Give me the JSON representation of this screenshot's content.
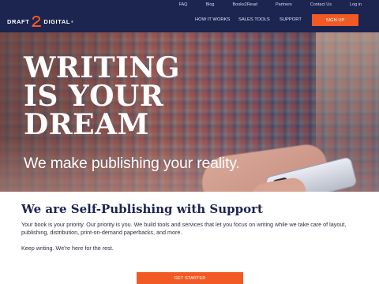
{
  "utility_nav": {
    "items": [
      "FAQ",
      "Blog",
      "Books2Read",
      "Partners",
      "Contact Us",
      "Log in"
    ]
  },
  "header": {
    "logo_left": "DRAFT",
    "logo_right": "DIGITAL",
    "logo_mark": "2",
    "nav": [
      "HOW IT WORKS",
      "SALES TOOLS",
      "SUPPORT"
    ],
    "signup_label": "SIGN UP"
  },
  "hero": {
    "title_lines": [
      "WRITING",
      "IS YOUR",
      "DREAM"
    ],
    "subtitle": "We make publishing your reality."
  },
  "content": {
    "heading": "We are Self-Publishing with Support",
    "paragraph1": "Your book is your priority. Our priority is you. We build tools and services that let you focus on writing while we take care of layout, publishing, distribution, print-on-demand paperbacks, and more.",
    "paragraph2": "Keep writing. We're here for the rest.",
    "cta_label": "GET STARTED"
  },
  "colors": {
    "navy": "#1c2450",
    "orange": "#f15a24",
    "text": "#2c2f3e"
  }
}
